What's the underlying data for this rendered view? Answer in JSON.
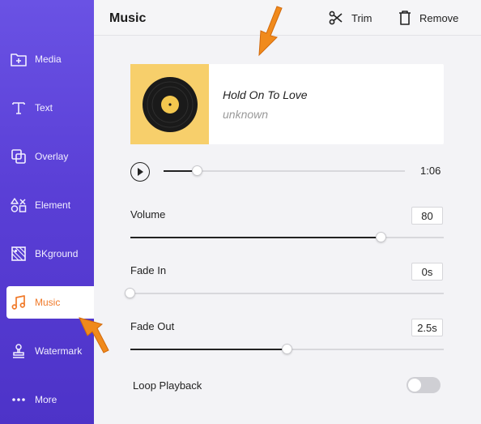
{
  "sidebar": {
    "items": [
      {
        "label": "Media",
        "icon": "media-add-icon"
      },
      {
        "label": "Text",
        "icon": "text-icon"
      },
      {
        "label": "Overlay",
        "icon": "overlay-icon"
      },
      {
        "label": "Element",
        "icon": "element-icon"
      },
      {
        "label": "BKground",
        "icon": "background-icon"
      },
      {
        "label": "Music",
        "icon": "music-note-icon",
        "active": true
      },
      {
        "label": "Watermark",
        "icon": "stamp-icon"
      },
      {
        "label": "More",
        "icon": "more-dots-icon"
      }
    ]
  },
  "header": {
    "title": "Music",
    "trim_label": "Trim",
    "remove_label": "Remove"
  },
  "track": {
    "title": "Hold On To Love",
    "artist": "unknown"
  },
  "player": {
    "time": "1:06",
    "progress": 0.14
  },
  "controls": {
    "volume": {
      "label": "Volume",
      "value": "80",
      "level": 0.8
    },
    "fade_in": {
      "label": "Fade In",
      "value": "0s",
      "level": 0.0
    },
    "fade_out": {
      "label": "Fade Out",
      "value": "2.5s",
      "level": 0.5
    },
    "loop": {
      "label": "Loop Playback",
      "enabled": false
    }
  },
  "colors": {
    "sidebar": "#5a3fd6",
    "accent": "#f07a2a",
    "cover": "#f7cf6b"
  }
}
